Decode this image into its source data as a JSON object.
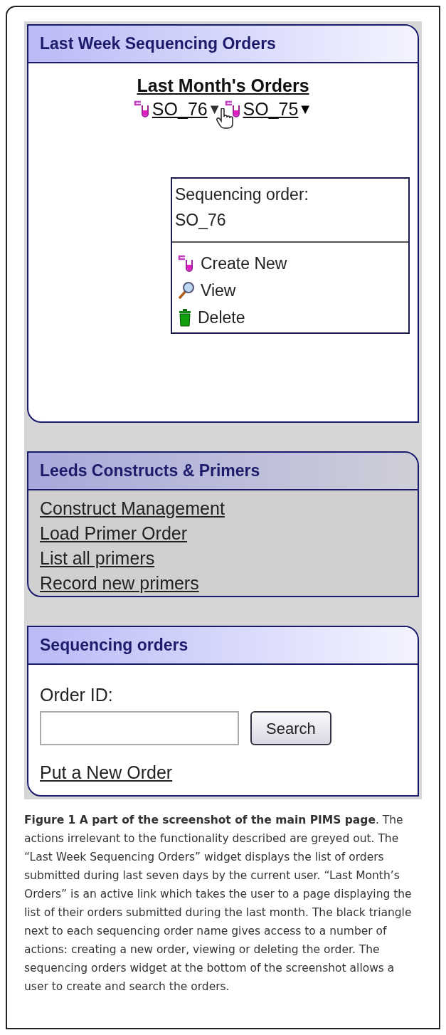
{
  "panels": [
    {
      "kind": "orders",
      "title": "Last Week Sequencing Orders",
      "disabled": false,
      "month_link": "Last Month's Orders",
      "orders": [
        {
          "name": "SO_76",
          "toggle": "▼",
          "menu_open": true
        },
        {
          "name": "SO_75",
          "toggle": "▼",
          "menu_open": false
        }
      ],
      "menu": {
        "heading": "Sequencing order:",
        "order": "SO_76",
        "items": [
          {
            "kind": "create",
            "label": "Create New"
          },
          {
            "kind": "view",
            "label": "View"
          },
          {
            "kind": "delete",
            "label": "Delete"
          }
        ]
      }
    },
    {
      "kind": "links",
      "title": "Leeds Constructs & Primers",
      "disabled": true,
      "links": [
        "Construct Management",
        "Load Primer Order",
        "List all primers",
        "Record new primers"
      ]
    },
    {
      "kind": "search",
      "title": "Sequencing orders",
      "disabled": false,
      "field_label": "Order ID:",
      "button": "Search",
      "link": "Put a New Order"
    }
  ],
  "caption": "**Figure 1 A part of the screenshot of the main PIMS page**. The actions irrelevant to the functionality described are greyed out. The “Last Week Sequencing Orders” widget displays the list of orders submitted during last seven days by the current user. “Last Month’s Orders” is an active link which takes the user to a page displaying the list of their orders submitted during the last month. The black triangle next to each sequencing order name gives access to a number of actions: creating a new order, viewing or deleting the order. The sequencing orders widget at the bottom of the screenshot allows a user to create and search the orders."
}
